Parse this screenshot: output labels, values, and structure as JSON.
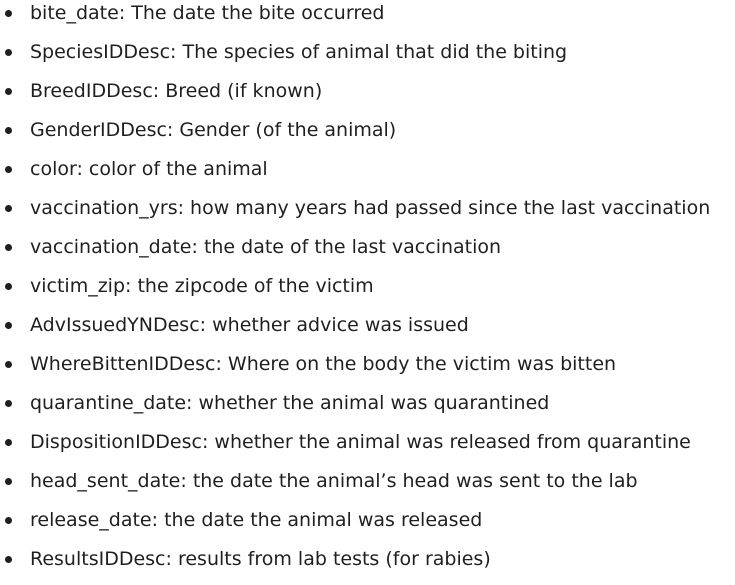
{
  "fields": [
    {
      "name": "bite_date",
      "desc": "The date the bite occurred"
    },
    {
      "name": "SpeciesIDDesc",
      "desc": "The species of animal that did the biting"
    },
    {
      "name": "BreedIDDesc",
      "desc": "Breed (if known)"
    },
    {
      "name": "GenderIDDesc",
      "desc": "Gender (of the animal)"
    },
    {
      "name": "color",
      "desc": "color of the animal"
    },
    {
      "name": "vaccination_yrs",
      "desc": "how many years had passed since the last vaccination"
    },
    {
      "name": "vaccination_date",
      "desc": "the date of the last vaccination"
    },
    {
      "name": "victim_zip",
      "desc": "the zipcode of the victim"
    },
    {
      "name": "AdvIssuedYNDesc",
      "desc": "whether advice was issued"
    },
    {
      "name": "WhereBittenIDDesc",
      "desc": "Where on the body the victim was bitten"
    },
    {
      "name": "quarantine_date",
      "desc": "whether the animal was quarantined"
    },
    {
      "name": "DispositionIDDesc",
      "desc": "whether the animal was released from quarantine"
    },
    {
      "name": "head_sent_date",
      "desc": "the date the animal’s head was sent to the lab"
    },
    {
      "name": "release_date",
      "desc": "the date the animal was released"
    },
    {
      "name": "ResultsIDDesc",
      "desc": "results from lab tests (for rabies)"
    }
  ]
}
